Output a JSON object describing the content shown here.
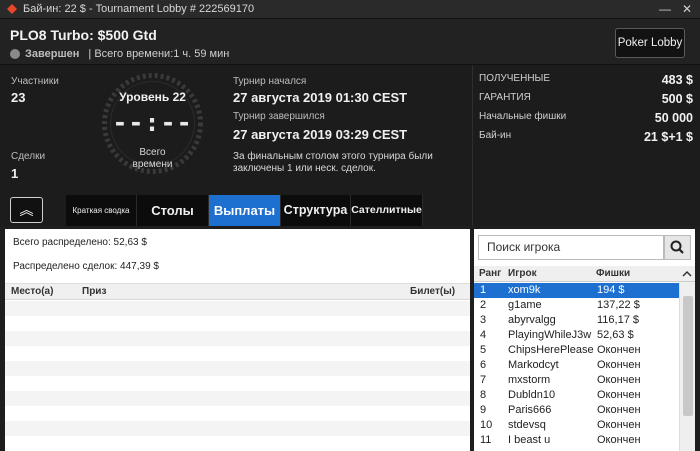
{
  "window": {
    "title": "Бай-ин: 22 $ - Tournament Lobby # 222569170",
    "min_glyph": "—",
    "close_glyph": "✕"
  },
  "header": {
    "tournament_name": "PLO8 Turbo: $500 Gtd",
    "status": "Завершен",
    "total_time": "| Всего времени:1 ч. 59 мин",
    "lobby_button": "Poker Lobby"
  },
  "info": {
    "participants_label": "Участники",
    "participants_value": "23",
    "deals_label": "Сделки",
    "deals_value": "1",
    "level": "Уровень 22",
    "clock": "--:--",
    "clock_label_line1": "Всего",
    "clock_label_line2": "времени",
    "start_label": "Турнир начался",
    "start_value": "27 августа 2019  01:30 CEST",
    "end_label": "Турнир завершился",
    "end_value": "27 августа 2019  03:29 CEST",
    "note": "За финальным столом этого турнира были заключены 1 или неск. сделок."
  },
  "stats": [
    {
      "label": "ПОЛУЧЕННЫЕ",
      "value": "483 $"
    },
    {
      "label": "ГАРАНТИЯ",
      "value": "500 $"
    },
    {
      "label": "Начальные фишки",
      "value": "50 000"
    },
    {
      "label": "Бай-ин",
      "value": "21 $+1 $"
    }
  ],
  "tabs": {
    "collapse_glyph": "︽",
    "summary": "Краткая сводка",
    "tables": "Столы",
    "payouts": "Выплаты",
    "structure": "Структура",
    "satellites": "Сателлитные"
  },
  "payouts": {
    "total_distributed": "Всего распределено: 52,63 $",
    "deals_distributed": "Распределено сделок: 447,39 $",
    "col_place": "Место(а)",
    "col_prize": "Приз",
    "col_ticket": "Билет(ы)"
  },
  "players": {
    "search_placeholder": "Поиск игрока",
    "col_rank": "Ранг",
    "col_player": "Игрок",
    "col_chips": "Фишки",
    "rows": [
      {
        "rank": "1",
        "name": "xom9k",
        "chips": "194 $"
      },
      {
        "rank": "2",
        "name": "g1ame",
        "chips": "137,22 $"
      },
      {
        "rank": "3",
        "name": "abyrvalgg",
        "chips": "116,17 $"
      },
      {
        "rank": "4",
        "name": "PlayingWhileJ3w",
        "chips": "52,63 $"
      },
      {
        "rank": "5",
        "name": "ChipsHerePlease",
        "chips": "Окончен"
      },
      {
        "rank": "6",
        "name": "Markodcyt",
        "chips": "Окончен"
      },
      {
        "rank": "7",
        "name": "mxstorm",
        "chips": "Окончен"
      },
      {
        "rank": "8",
        "name": "Dubldn10",
        "chips": "Окончен"
      },
      {
        "rank": "9",
        "name": "Paris666",
        "chips": "Окончен"
      },
      {
        "rank": "10",
        "name": "stdevsq",
        "chips": "Окончен"
      },
      {
        "rank": "11",
        "name": "I beast u",
        "chips": "Окончен"
      }
    ]
  },
  "colors": {
    "accent": "#1d6fd0",
    "logo": "#e8462b"
  }
}
